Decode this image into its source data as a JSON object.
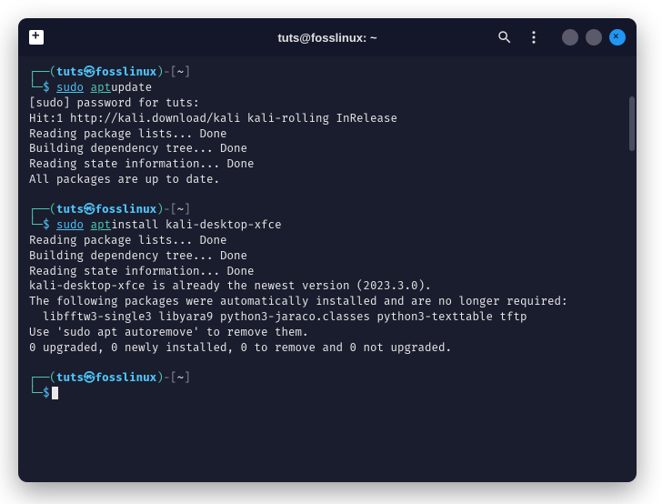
{
  "window": {
    "title": "tuts@fosslinux: ~"
  },
  "prompts": {
    "user": "tuts",
    "host": "fosslinux",
    "sep_at": "㉿",
    "path": "~",
    "open_paren": "(",
    "close_paren": ")",
    "dash_open": "-[",
    "dash_close": "]",
    "top_corner": "┌──",
    "bot_corner": "└─",
    "dollar": "$"
  },
  "blocks": [
    {
      "cmd": {
        "sudo": "sudo",
        "apt": "apt",
        "rest": " update"
      },
      "out": [
        "[sudo] password for tuts:",
        "Hit:1 http://kali.download/kali kali-rolling InRelease",
        "Reading package lists... Done",
        "Building dependency tree... Done",
        "Reading state information... Done",
        "All packages are up to date."
      ]
    },
    {
      "cmd": {
        "sudo": "sudo",
        "apt": "apt",
        "rest": " install kali-desktop-xfce"
      },
      "out": [
        "Reading package lists... Done",
        "Building dependency tree... Done",
        "Reading state information... Done",
        "kali-desktop-xfce is already the newest version (2023.3.0).",
        "The following packages were automatically installed and are no longer required:",
        "  libfftw3-single3 libyara9 python3-jaraco.classes python3-texttable tftp",
        "Use 'sudo apt autoremove' to remove them.",
        "0 upgraded, 0 newly installed, 0 to remove and 0 not upgraded."
      ]
    }
  ]
}
